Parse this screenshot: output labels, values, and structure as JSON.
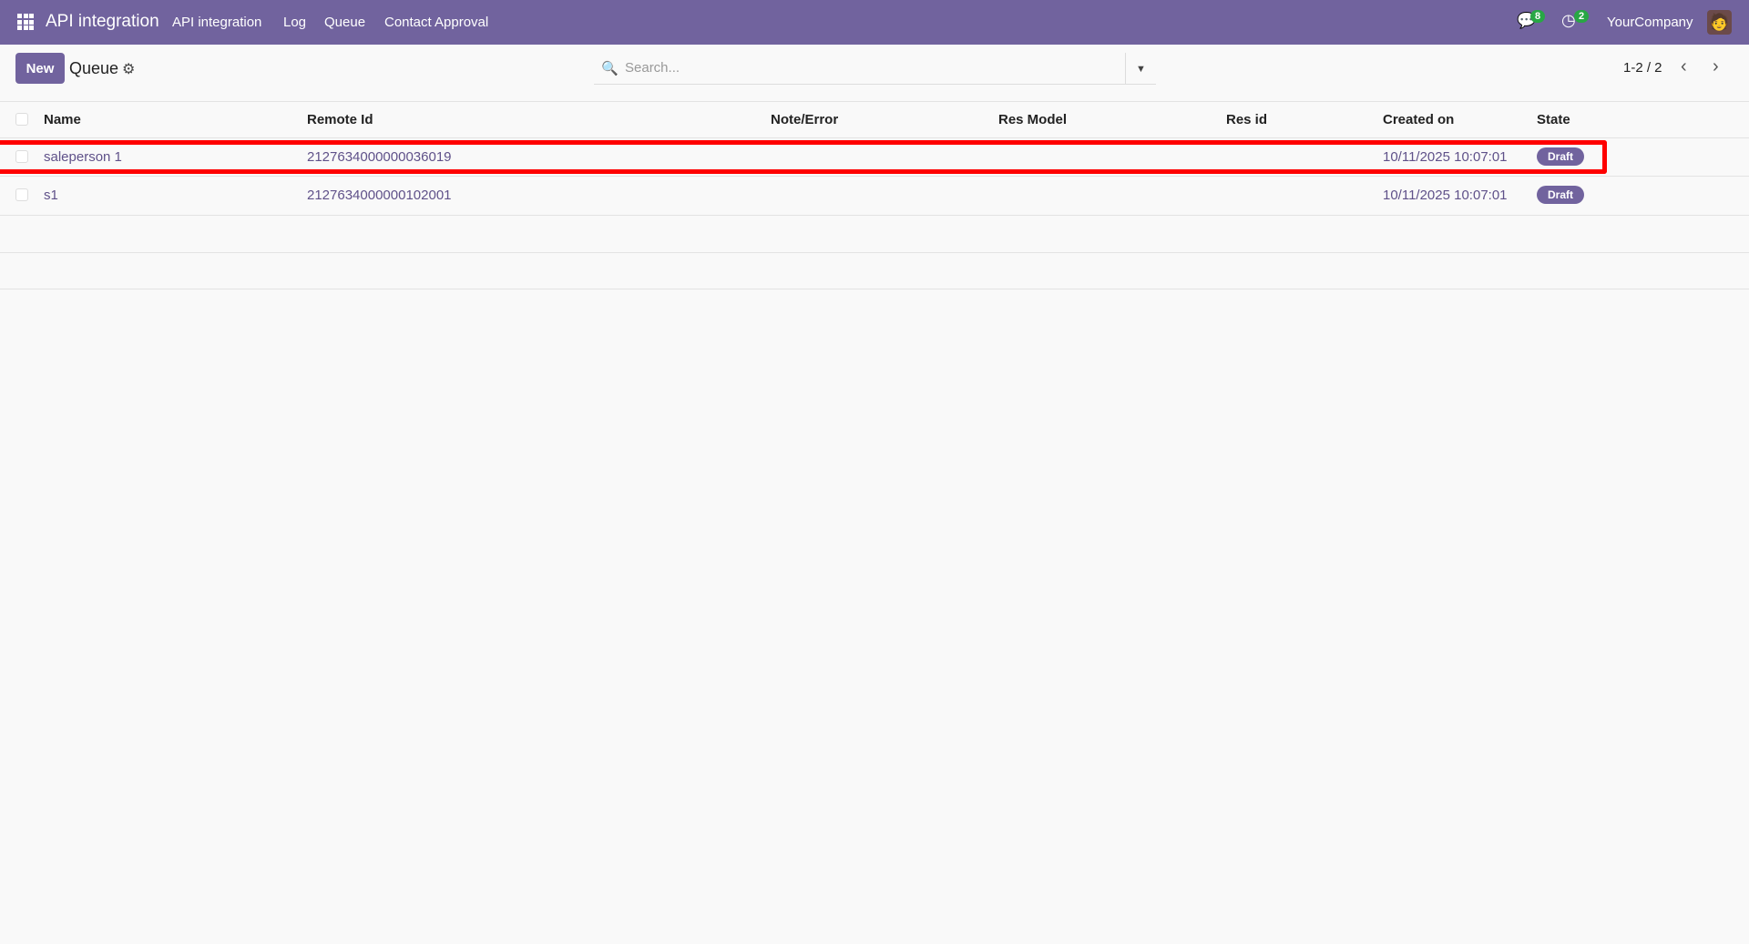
{
  "navbar": {
    "app_title": "API integration",
    "menu": [
      "API integration",
      "Log",
      "Queue",
      "Contact Approval"
    ],
    "messages_count": "8",
    "activities_count": "2",
    "company": "YourCompany"
  },
  "toolbar": {
    "new_label": "New",
    "title": "Queue",
    "search_placeholder": "Search...",
    "pager": "1-2 / 2"
  },
  "table": {
    "columns": [
      "Name",
      "Remote Id",
      "Note/Error",
      "Res Model",
      "Res id",
      "Created on",
      "State"
    ],
    "rows": [
      {
        "name": "saleperson 1",
        "remote_id": "2127634000000036019",
        "note": "",
        "res_model": "",
        "res_id": "",
        "created_on": "10/11/2025 10:07:01",
        "state": "Draft"
      },
      {
        "name": "s1",
        "remote_id": "2127634000000102001",
        "note": "",
        "res_model": "",
        "res_id": "",
        "created_on": "10/11/2025 10:07:01",
        "state": "Draft"
      }
    ]
  },
  "colors": {
    "brand": "#71639e",
    "highlight": "#ff0000",
    "badge": "#28a745"
  }
}
